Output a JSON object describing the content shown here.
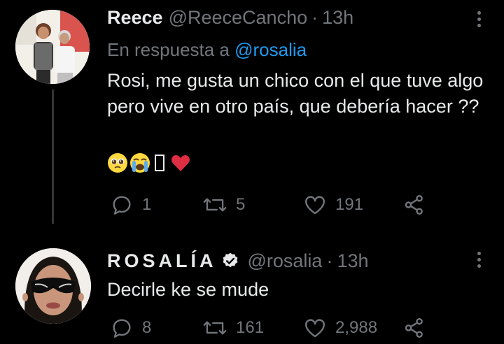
{
  "tweets": [
    {
      "name": "Reece",
      "handle": "@ReeceCancho",
      "time": "13h",
      "reply_prefix": "En respuesta a",
      "reply_mention": "@rosalia",
      "text": "Rosi, me gusta un chico con el que tuve algo pero vive en otro país, que debería hacer ??",
      "emojis": [
        "pleading-face-emoji",
        "crying-face-emoji",
        "missing-glyph",
        "red-heart-emoji"
      ],
      "replies": "1",
      "retweets": "5",
      "likes": "191"
    },
    {
      "name": "ROSALÍA",
      "handle": "@rosalia",
      "time": "13h",
      "verified": true,
      "text": "Decirle ke se mude",
      "replies": "8",
      "retweets": "161",
      "likes": "2,988"
    }
  ],
  "colors": {
    "background": "#000000",
    "text": "#e7e9ea",
    "muted": "#71767b",
    "link": "#1d9bf0",
    "heart": "#e0245e"
  },
  "icons": [
    "reply-icon",
    "retweet-icon",
    "like-icon",
    "share-icon",
    "more-icon",
    "verified-badge-icon"
  ]
}
